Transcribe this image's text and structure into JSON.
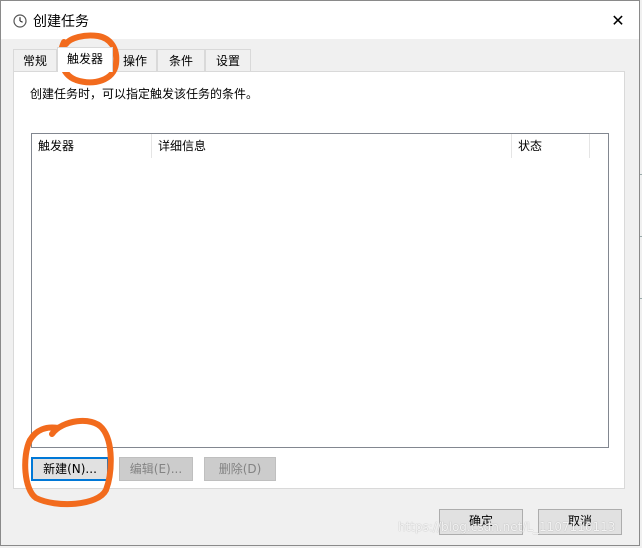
{
  "window": {
    "title": "创建任务",
    "close_glyph": "✕"
  },
  "tabs": [
    {
      "label": "常规"
    },
    {
      "label": "触发器"
    },
    {
      "label": "操作"
    },
    {
      "label": "条件"
    },
    {
      "label": "设置"
    }
  ],
  "active_tab": "触发器",
  "panel": {
    "description": "创建任务时，可以指定触发该任务的条件。"
  },
  "list": {
    "columns": [
      "触发器",
      "详细信息",
      "状态"
    ],
    "rows": []
  },
  "buttons": {
    "new": "新建(N)...",
    "edit": "编辑(E)...",
    "delete": "删除(D)",
    "ok": "确定",
    "cancel": "取消"
  },
  "watermark": "https://blog.csdn.net/L_1107110113",
  "colors": {
    "annotation": "#f26b1d",
    "focus": "#0078d7"
  }
}
